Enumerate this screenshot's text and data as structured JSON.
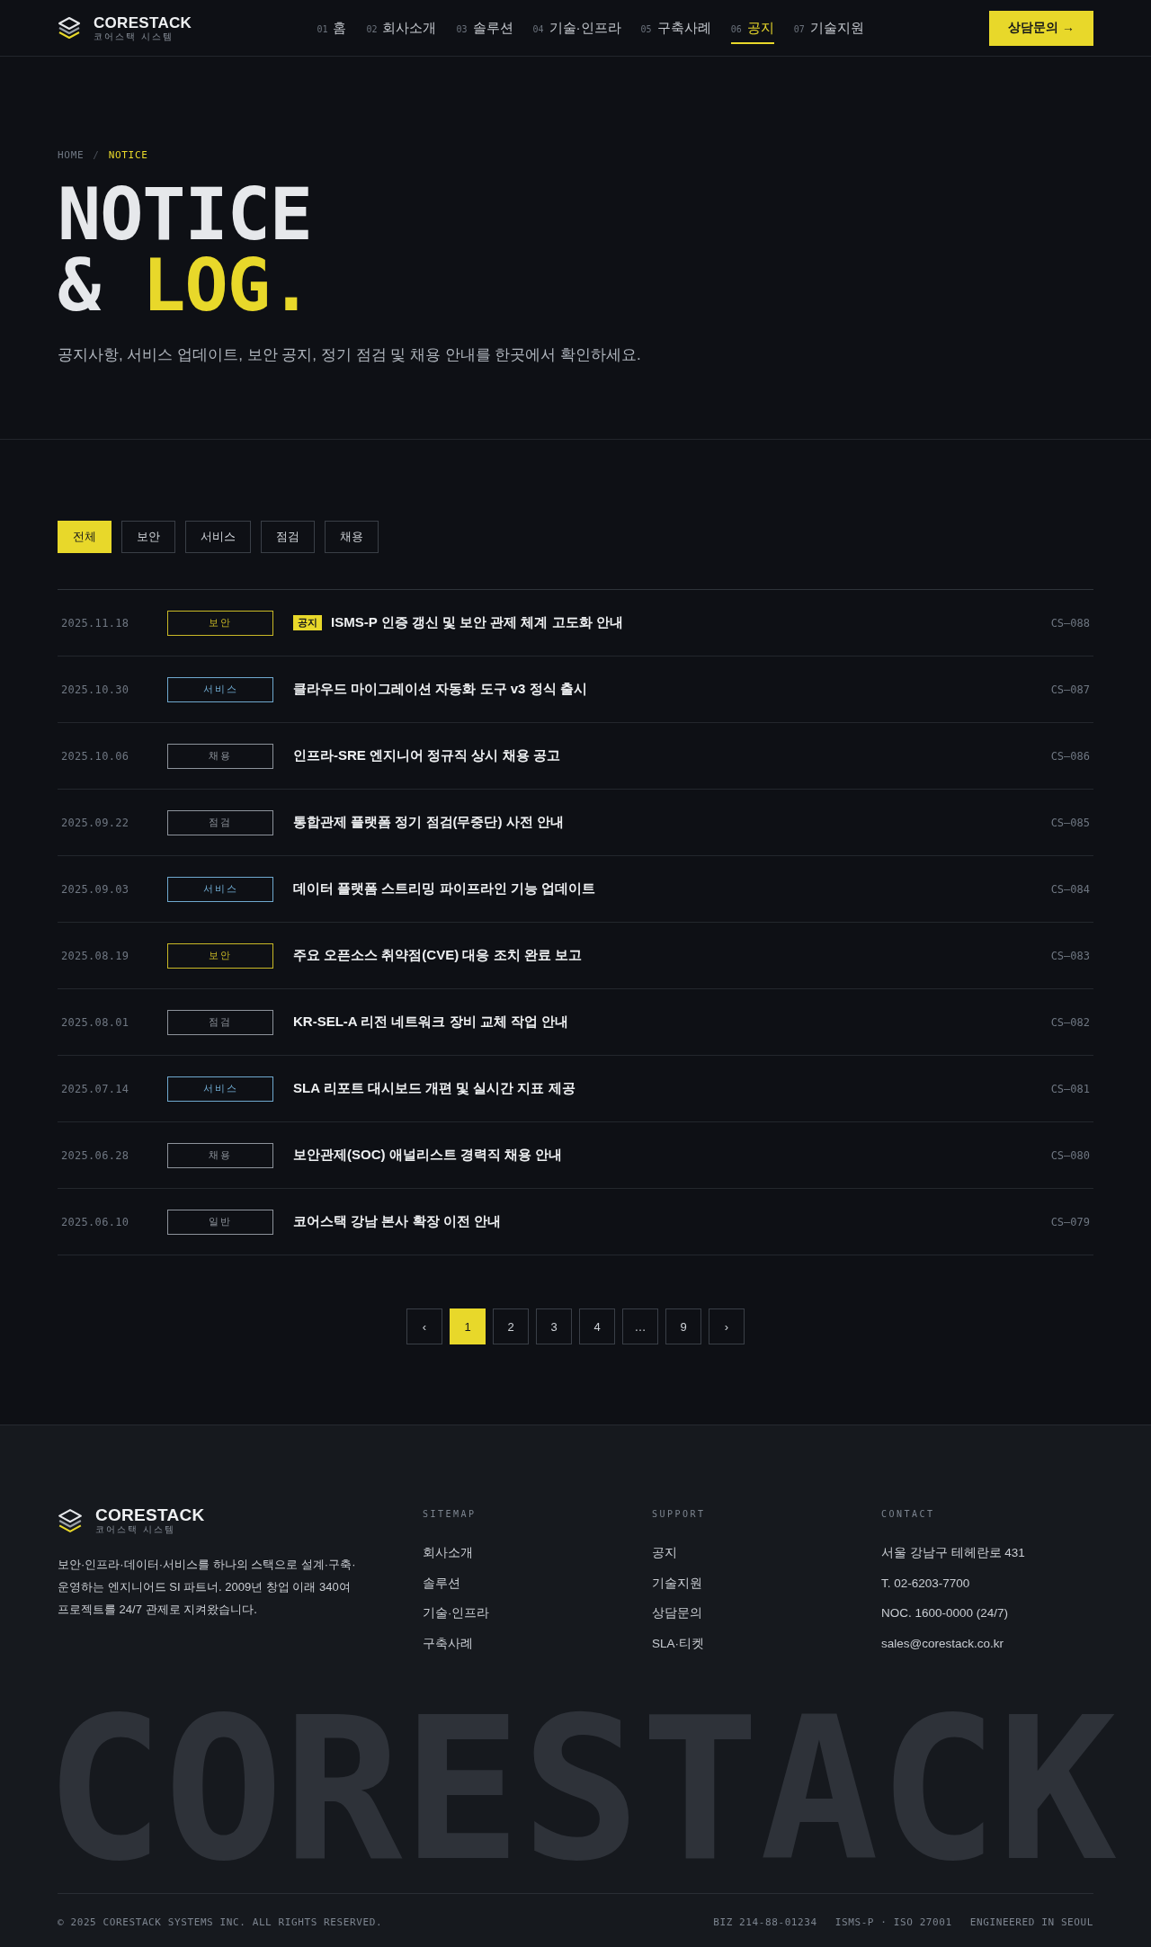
{
  "header": {
    "logo": {
      "name": "CORESTACK",
      "tagline": "코어스택 시스템"
    },
    "nav": [
      {
        "number": "01",
        "label": "홈",
        "selected": false
      },
      {
        "number": "02",
        "label": "회사소개",
        "selected": false
      },
      {
        "number": "03",
        "label": "솔루션",
        "selected": false
      },
      {
        "number": "04",
        "label": "기술·인프라",
        "selected": false
      },
      {
        "number": "05",
        "label": "구축사례",
        "selected": false
      },
      {
        "number": "06",
        "label": "공지",
        "selected": true
      },
      {
        "number": "07",
        "label": "기술지원",
        "selected": false
      }
    ],
    "cta": "상담문의 →"
  },
  "hero": {
    "breadcrumb": [
      {
        "label": "HOME",
        "current": false
      },
      {
        "label": "NOTICE",
        "current": true
      }
    ],
    "breadcrumb_separator": "/",
    "title": {
      "line_1": "NOTICE",
      "line_2": "&",
      "accent": "LOG."
    },
    "description": "공지사항, 서비스 업데이트, 보안 공지, 정기 점검 및 채용 안내를 한곳에서 확인하세요."
  },
  "filters": [
    {
      "label": "전체",
      "selected": true
    },
    {
      "label": "보안",
      "selected": false
    },
    {
      "label": "서비스",
      "selected": false
    },
    {
      "label": "점검",
      "selected": false
    },
    {
      "label": "채용",
      "selected": false
    }
  ],
  "notices": [
    {
      "date": "2025.11.18",
      "tag": {
        "label": "보안",
        "color": "#c9b926"
      },
      "badge": "공지",
      "title": "ISMS-P 인증 갱신 및 보안 관제 체계 고도화 안내",
      "code": "CS—088"
    },
    {
      "date": "2025.10.30",
      "tag": {
        "label": "서비스",
        "color": "#6fa9cf"
      },
      "title": "클라우드 마이그레이션 자동화 도구 v3 정식 출시",
      "code": "CS—087"
    },
    {
      "date": "2025.10.06",
      "tag": {
        "label": "채용",
        "color": "#8d939b"
      },
      "title": "인프라-SRE 엔지니어 정규직 상시 채용 공고",
      "code": "CS—086"
    },
    {
      "date": "2025.09.22",
      "tag": {
        "label": "점검",
        "color": "#8d939b"
      },
      "title": "통합관제 플랫폼 정기 점검(무중단) 사전 안내",
      "code": "CS—085"
    },
    {
      "date": "2025.09.03",
      "tag": {
        "label": "서비스",
        "color": "#6fa9cf"
      },
      "title": "데이터 플랫폼 스트리밍 파이프라인 기능 업데이트",
      "code": "CS—084"
    },
    {
      "date": "2025.08.19",
      "tag": {
        "label": "보안",
        "color": "#c9b926"
      },
      "title": "주요 오픈소스 취약점(CVE) 대응 조치 완료 보고",
      "code": "CS—083"
    },
    {
      "date": "2025.08.01",
      "tag": {
        "label": "점검",
        "color": "#8d939b"
      },
      "title": "KR-SEL-A 리전 네트워크 장비 교체 작업 안내",
      "code": "CS—082"
    },
    {
      "date": "2025.07.14",
      "tag": {
        "label": "서비스",
        "color": "#6fa9cf"
      },
      "title": "SLA 리포트 대시보드 개편 및 실시간 지표 제공",
      "code": "CS—081"
    },
    {
      "date": "2025.06.28",
      "tag": {
        "label": "채용",
        "color": "#8d939b"
      },
      "title": "보안관제(SOC) 애널리스트 경력직 채용 안내",
      "code": "CS—080"
    },
    {
      "date": "2025.06.10",
      "tag": {
        "label": "일반",
        "color": "#8d939b"
      },
      "title": "코어스택 강남 본사 확장 이전 안내",
      "code": "CS—079"
    }
  ],
  "pagination": [
    {
      "label": "‹",
      "selected": false
    },
    {
      "label": "1",
      "selected": true
    },
    {
      "label": "2",
      "selected": false
    },
    {
      "label": "3",
      "selected": false
    },
    {
      "label": "4",
      "selected": false
    },
    {
      "label": "…",
      "selected": false
    },
    {
      "label": "9",
      "selected": false
    },
    {
      "label": "›",
      "selected": false
    }
  ],
  "footer": {
    "logo": {
      "name": "CORESTACK",
      "tagline": "코어스택 시스템"
    },
    "description": "보안·인프라·데이터·서비스를 하나의 스택으로 설계·구축·운영하는 엔지니어드 SI 파트너. 2009년 창업 이래 340여 프로젝트를 24/7 관제로 지켜왔습니다.",
    "columns": [
      {
        "heading": "SITEMAP",
        "links": [
          "회사소개",
          "솔루션",
          "기술·인프라",
          "구축사례"
        ]
      },
      {
        "heading": "SUPPORT",
        "links": [
          "공지",
          "기술지원",
          "상담문의",
          "SLA·티켓"
        ]
      }
    ],
    "contact": {
      "heading": "CONTACT",
      "items": [
        "서울 강남구 테헤란로 431",
        "T. 02-6203-7700",
        "NOC. 1600-0000 (24/7)",
        "sales@corestack.co.kr"
      ]
    },
    "wordmark": "CORESTACK"
  },
  "bottom_bar": {
    "copyright": "© 2025 CORESTACK SYSTEMS INC. ALL RIGHTS RESERVED.",
    "items": [
      "BIZ 214-88-01234",
      "ISMS-P · ISO 27001",
      "ENGINEERED IN SEOUL"
    ]
  }
}
